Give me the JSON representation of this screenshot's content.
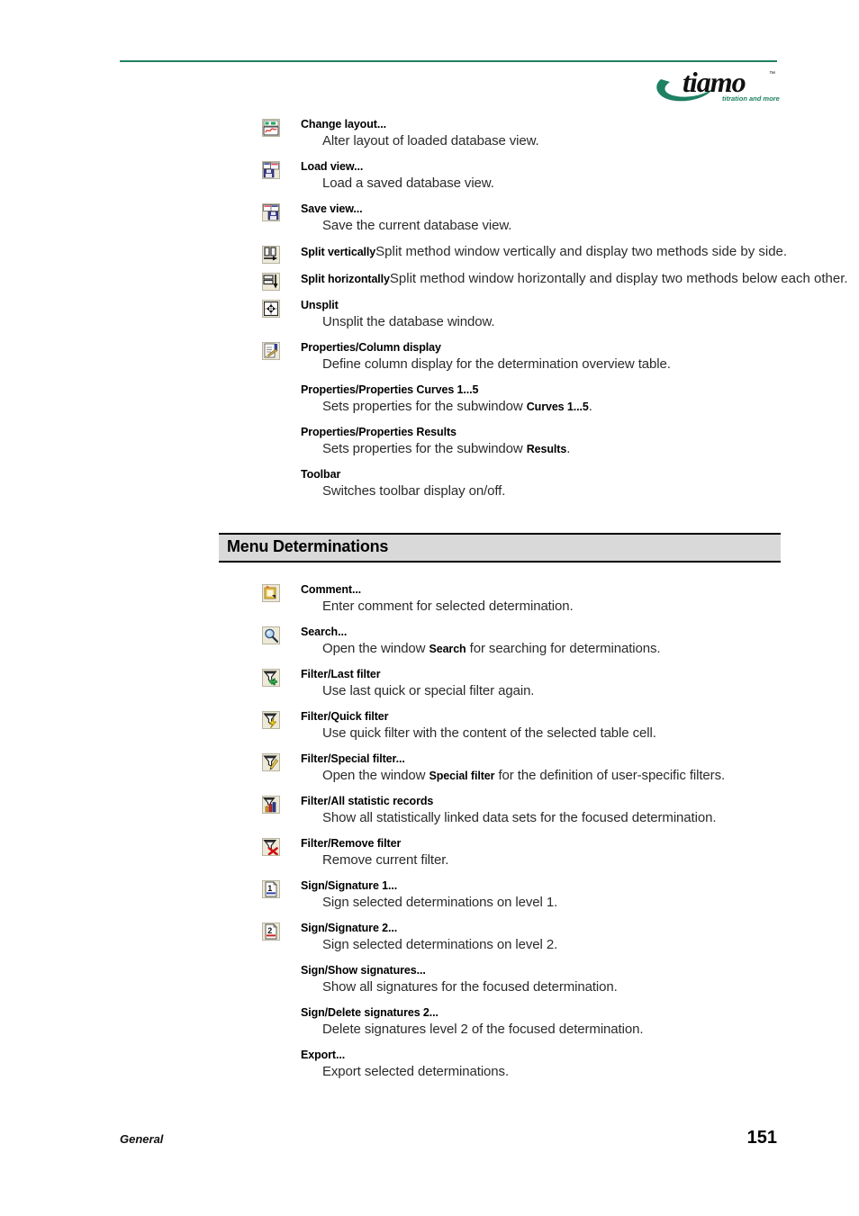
{
  "header": {
    "logo_name": "tiamo-logo",
    "logo_wordmark": "tiamo",
    "logo_tm": "TM",
    "logo_tagline": "titration and more",
    "brand_green": "#21815f",
    "rule_color": "#21815f"
  },
  "sections": [
    {
      "id": "menu-view-continued",
      "heading": null,
      "entries": [
        {
          "icon": "change-layout-icon",
          "title": "Change layout...",
          "title_runon": null,
          "desc_parts": [
            {
              "text": "Alter layout of loaded database view.",
              "bold": false
            }
          ]
        },
        {
          "icon": "load-view-icon",
          "title": "Load view...",
          "title_runon": null,
          "desc_parts": [
            {
              "text": "Load a saved database view.",
              "bold": false
            }
          ]
        },
        {
          "icon": "save-view-icon",
          "title": "Save view...",
          "title_runon": null,
          "desc_parts": [
            {
              "text": "Save the current database view.",
              "bold": false
            }
          ]
        },
        {
          "icon": "split-vertically-icon",
          "title": "Split vertically",
          "title_runon": "Split method window vertically and display two methods side by side.",
          "desc_parts": []
        },
        {
          "icon": "split-horizontally-icon",
          "title": "Split horizontally",
          "title_runon": "Split method window horizontally and display two methods below each other.",
          "desc_parts": []
        },
        {
          "icon": "unsplit-icon",
          "title": "Unsplit",
          "title_runon": null,
          "desc_parts": [
            {
              "text": "Unsplit the database window.",
              "bold": false
            }
          ]
        },
        {
          "icon": "properties-column-display-icon",
          "title": "Properties/Column display",
          "title_runon": null,
          "desc_parts": [
            {
              "text": "Define column display for the determination overview table.",
              "bold": false
            }
          ]
        },
        {
          "icon": null,
          "title": "Properties/Properties Curves 1...5",
          "title_runon": null,
          "desc_parts": [
            {
              "text": "Sets properties for the subwindow ",
              "bold": false
            },
            {
              "text": "Curves 1...5",
              "bold": true
            },
            {
              "text": ".",
              "bold": false
            }
          ]
        },
        {
          "icon": null,
          "title": "Properties/Properties Results",
          "title_runon": null,
          "desc_parts": [
            {
              "text": "Sets properties for the subwindow ",
              "bold": false
            },
            {
              "text": "Results",
              "bold": true
            },
            {
              "text": ".",
              "bold": false
            }
          ]
        },
        {
          "icon": null,
          "title": "Toolbar",
          "title_runon": null,
          "desc_parts": [
            {
              "text": "Switches toolbar display on/off.",
              "bold": false
            }
          ]
        }
      ]
    },
    {
      "id": "menu-determinations",
      "heading": "Menu Determinations",
      "entries": [
        {
          "icon": "comment-icon",
          "title": "Comment...",
          "title_runon": null,
          "desc_parts": [
            {
              "text": "Enter comment for selected determination.",
              "bold": false
            }
          ]
        },
        {
          "icon": "search-icon",
          "title": "Search...",
          "title_runon": null,
          "desc_parts": [
            {
              "text": "Open the window ",
              "bold": false
            },
            {
              "text": "Search",
              "bold": true
            },
            {
              "text": " for searching for determinations.",
              "bold": false
            }
          ]
        },
        {
          "icon": "filter-last-icon",
          "title": "Filter/Last filter",
          "title_runon": null,
          "desc_parts": [
            {
              "text": "Use last quick or special filter again.",
              "bold": false
            }
          ]
        },
        {
          "icon": "filter-quick-icon",
          "title": "Filter/Quick filter",
          "title_runon": null,
          "desc_parts": [
            {
              "text": "Use quick filter with the content of the selected table cell.",
              "bold": false
            }
          ]
        },
        {
          "icon": "filter-special-icon",
          "title": "Filter/Special filter...",
          "title_runon": null,
          "desc_parts": [
            {
              "text": "Open the window ",
              "bold": false
            },
            {
              "text": "Special filter",
              "bold": true
            },
            {
              "text": " for the definition of user-specific filters.",
              "bold": false
            }
          ]
        },
        {
          "icon": "filter-statistic-icon",
          "title": "Filter/All statistic records",
          "title_runon": null,
          "desc_parts": [
            {
              "text": "Show all statistically linked data sets for the focused determination.",
              "bold": false
            }
          ]
        },
        {
          "icon": "filter-remove-icon",
          "title": "Filter/Remove filter",
          "title_runon": null,
          "desc_parts": [
            {
              "text": "Remove current filter.",
              "bold": false
            }
          ]
        },
        {
          "icon": "signature-1-icon",
          "title": "Sign/Signature 1...",
          "title_runon": null,
          "desc_parts": [
            {
              "text": "Sign selected determinations on level 1.",
              "bold": false
            }
          ]
        },
        {
          "icon": "signature-2-icon",
          "title": "Sign/Signature 2...",
          "title_runon": null,
          "desc_parts": [
            {
              "text": "Sign selected determinations on level 2.",
              "bold": false
            }
          ]
        },
        {
          "icon": null,
          "title": "Sign/Show signatures...",
          "title_runon": null,
          "desc_parts": [
            {
              "text": "Show all signatures for the focused determination.",
              "bold": false
            }
          ]
        },
        {
          "icon": null,
          "title": "Sign/Delete signatures 2...",
          "title_runon": null,
          "desc_parts": [
            {
              "text": "Delete signatures level 2 of the focused determination.",
              "bold": false
            }
          ]
        },
        {
          "icon": null,
          "title": "Export...",
          "title_runon": null,
          "desc_parts": [
            {
              "text": "Export selected determinations.",
              "bold": false
            }
          ]
        }
      ]
    }
  ],
  "footer": {
    "label": "General",
    "page_number": "151"
  }
}
